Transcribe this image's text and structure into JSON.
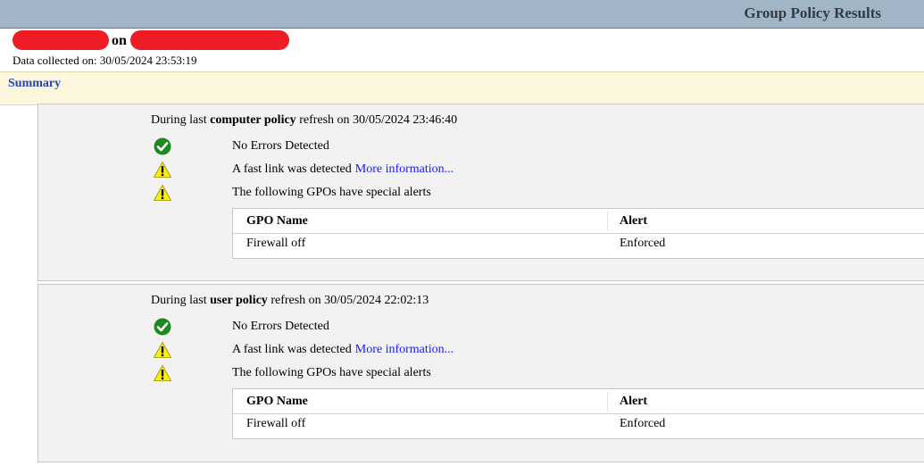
{
  "header": {
    "title": "Group Policy Results",
    "on_word": "on",
    "collected": "Data collected on: 30/05/2024 23:53:19"
  },
  "summary": {
    "label": "Summary"
  },
  "sections": [
    {
      "prefix": "During last ",
      "bold": "computer policy",
      "suffix": " refresh on 30/05/2024 23:46:40",
      "status": [
        {
          "icon": "success-check-icon",
          "text": "No Errors Detected",
          "link": ""
        },
        {
          "icon": "warning-icon",
          "text": "A fast link was detected",
          "link": "More information..."
        },
        {
          "icon": "warning-icon",
          "text": "The following GPOs have special alerts",
          "link": ""
        }
      ],
      "table": {
        "headers": [
          "GPO Name",
          "Alert"
        ],
        "rows": [
          [
            "Firewall off",
            "Enforced"
          ]
        ]
      }
    },
    {
      "prefix": "During last ",
      "bold": "user policy",
      "suffix": " refresh on 30/05/2024 22:02:13",
      "status": [
        {
          "icon": "success-check-icon",
          "text": "No Errors Detected",
          "link": ""
        },
        {
          "icon": "warning-icon",
          "text": "A fast link was detected",
          "link": "More information..."
        },
        {
          "icon": "warning-icon",
          "text": "The following GPOs have special alerts",
          "link": ""
        }
      ],
      "table": {
        "headers": [
          "GPO Name",
          "Alert"
        ],
        "rows": [
          [
            "Firewall off",
            "Enforced"
          ]
        ]
      }
    }
  ],
  "colors": {
    "titlebar": "#a1b5c7",
    "summary_bg": "#fcf7dc",
    "link": "#1a1aff",
    "success": "#1e8a1e",
    "warning": "#ffee00",
    "redaction": "#ee1c25"
  }
}
